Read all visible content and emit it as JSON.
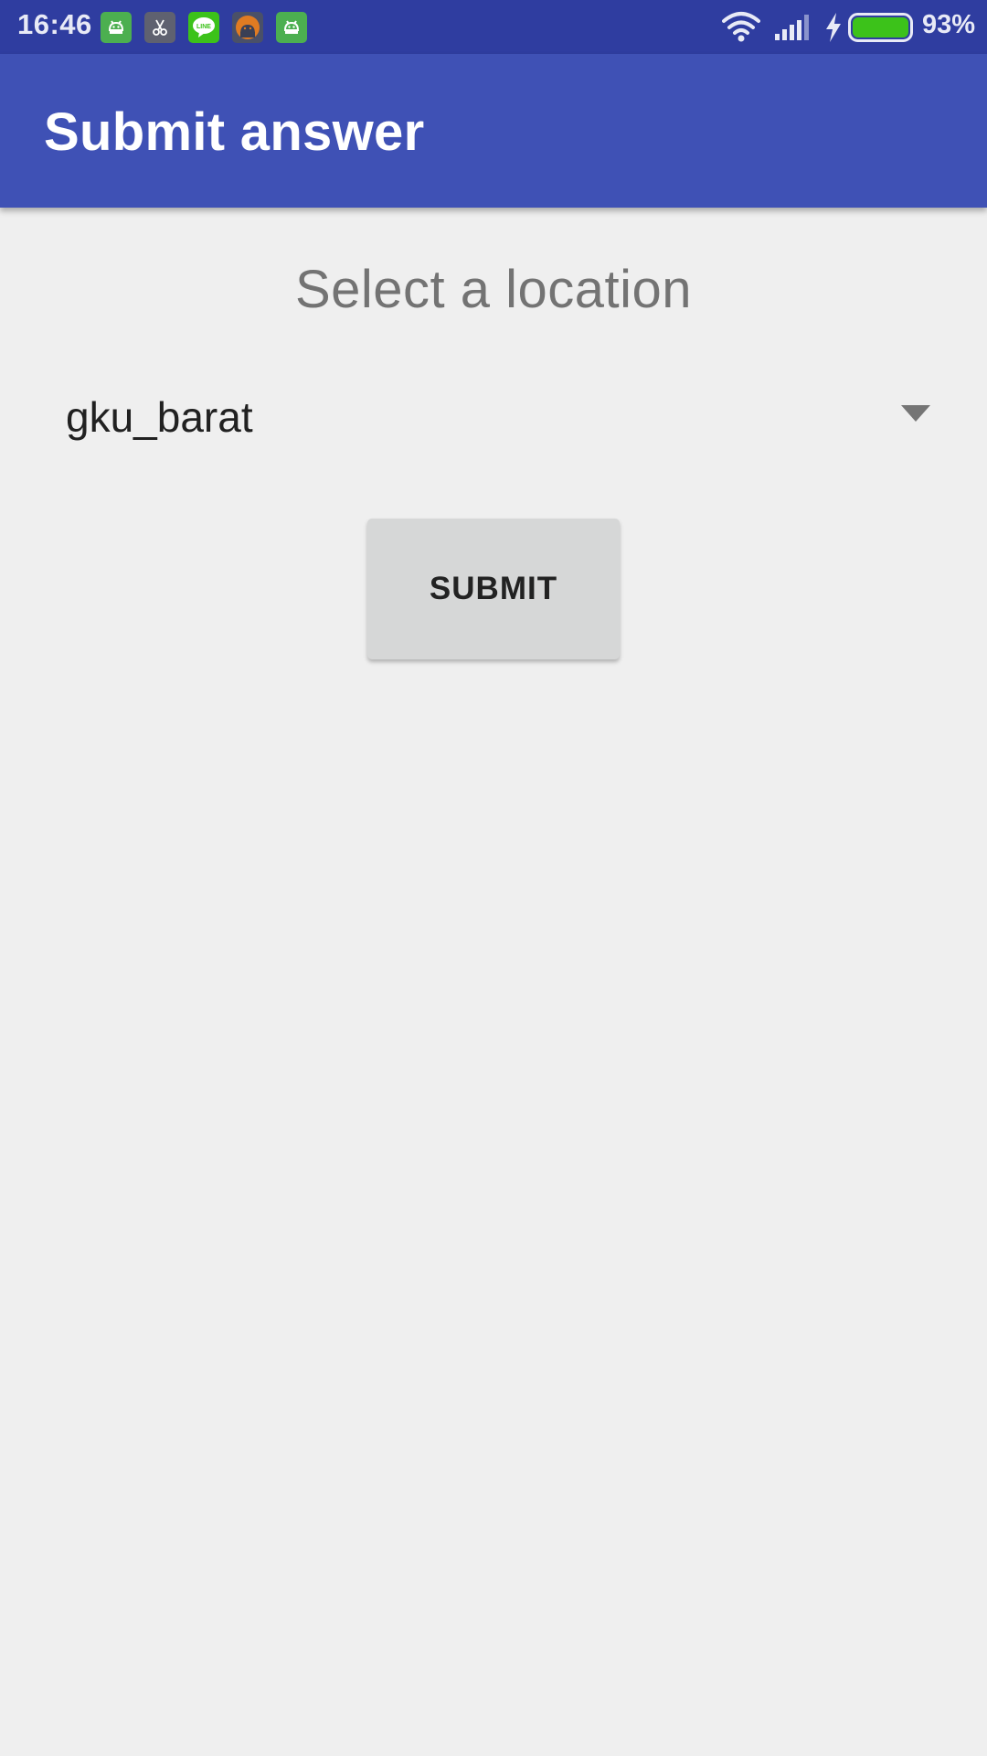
{
  "status_bar": {
    "time": "16:46",
    "battery_percent": "93%",
    "battery_level": 0.93,
    "notification_icons": [
      "android-robot-icon",
      "scissors-app-icon",
      "line-app-icon",
      "android-debug-icon",
      "android-robot-icon"
    ],
    "colors": {
      "background": "#2f3da0",
      "battery_fill": "#3cc21a"
    }
  },
  "app_bar": {
    "title": "Submit answer",
    "color": "#3f51b5"
  },
  "content": {
    "prompt": "Select a location",
    "location_spinner": {
      "selected_value": "gku_barat",
      "icon": "dropdown-triangle-icon"
    },
    "submit_label": "SUBMIT"
  }
}
